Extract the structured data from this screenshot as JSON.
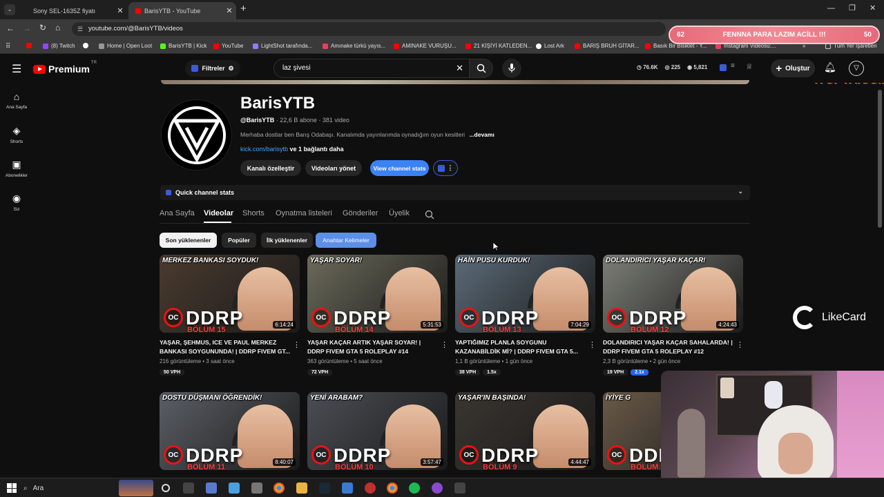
{
  "browser": {
    "tabs": [
      {
        "title": "Sony SEL-1635Z fiyatı",
        "active": false
      },
      {
        "title": "BarisYTB - YouTube",
        "active": true
      }
    ],
    "url": "youtube.com/@BarisYTB/videos",
    "bookmarks": [
      "(8) Twitch",
      "Home | Open Loot",
      "BarisYTB | Kick",
      "YouTube",
      "LightShot tarafında...",
      "Amınake türkü yayıs...",
      "AMINAKE VURUŞU...",
      "21 KİŞİYİ KATLEDEN...",
      "Lost Ark",
      "BARIŞ BRUH GİTAR...",
      "Basık Bir Bisiklet - Y...",
      "Instagram Videosu:...",
      "Tüm Yer İşaretleri"
    ]
  },
  "overlay": {
    "left_num": "62",
    "text": "FENNNA PARA LAZIM ACİLL !!!",
    "right_num": "50",
    "site": "iTOPYA.COM",
    "likecard": "LikeCard"
  },
  "header": {
    "brand": "Premium",
    "brand_sup": "TR",
    "filters": "Filtreler",
    "search_value": "laz şivesi",
    "stats": [
      "76.6K",
      "225",
      "5,821"
    ],
    "create": "Oluştur"
  },
  "sidebar": [
    {
      "label": "Ana Sayfa",
      "icon": "home-icon"
    },
    {
      "label": "Shorts",
      "icon": "shorts-icon"
    },
    {
      "label": "Abonelikler",
      "icon": "subscriptions-icon"
    },
    {
      "label": "Siz",
      "icon": "you-icon"
    }
  ],
  "channel": {
    "name": "BarisYTB",
    "handle": "@BarisYTB",
    "subs": "· 22,6 B abone · 381 video",
    "description": "Merhaba dostlar ben Barış Odabaşı. Kanalımda yayınlarımda oynadığım oyun kesitleri",
    "more": "...devamı",
    "link": "kick.com/barisytb",
    "link_more": "ve 1 bağlantı daha",
    "buttons": [
      "Kanalı özelleştir",
      "Videoları yönet",
      "View channel stats"
    ],
    "quick_stats": "Quick channel stats"
  },
  "tabs": [
    "Ana Sayfa",
    "Videolar",
    "Shorts",
    "Oynatma listeleri",
    "Gönderiler",
    "Üyelik"
  ],
  "chips": [
    "Son yüklenenler",
    "Popüler",
    "İlk yüklenenler",
    "Anahtar Kelimeler"
  ],
  "videos": [
    {
      "top": "MERKEZ BANKASI SOYDUK!",
      "bolum": "BÖLÜM 15",
      "duration": "6:14:24",
      "title": "YAŞAR, ŞEHMUS, ICE VE PAUL MERKEZ BANKASI SOYGUNUNDA! | DDRP FIVEM GT...",
      "views": "216 görüntüleme",
      "age": "3 saat önce",
      "vph": "50 VPH",
      "mult": "",
      "bg": "#4a3b2f"
    },
    {
      "top": "YAŞAR SOYAR!",
      "bolum": "BÖLÜM 14",
      "duration": "5:31:53",
      "title": "YAŞAR KAÇAR ARTIK YAŞAR SOYAR! | DDRP FIVEM GTA 5 ROLEPLAY #14",
      "views": "363 görüntüleme",
      "age": "5 saat önce",
      "vph": "72 VPH",
      "mult": "",
      "bg": "#6b6a5a"
    },
    {
      "top": "HAİN PUSU KURDUK!",
      "bolum": "BÖLÜM 13",
      "duration": "7:04:29",
      "title": "YAPTIĞIMIZ PLANLA SOYGUNU KAZANABİLDİK Mİ? | DDRP FIVEM GTA 5...",
      "views": "1,1 B görüntüleme",
      "age": "1 gün önce",
      "vph": "38 VPH",
      "mult": "1.5x",
      "bg": "#5c6b78"
    },
    {
      "top": "DOLANDIRICI YAŞAR KAÇAR!",
      "bolum": "BÖLÜM 12",
      "duration": "4:24:43",
      "title": "DOLANDIRICI YAŞAR KAÇAR SAHALARDA! | DDRP FIVEM GTA 5 ROLEPLAY #12",
      "views": "2,3 B görüntüleme",
      "age": "2 gün önce",
      "vph": "19 VPH",
      "mult": "2.1x",
      "bg": "#7d7f77"
    },
    {
      "top": "DOSTU DÜŞMANI ÖĞRENDİK!",
      "bolum": "BÖLÜM 11",
      "duration": "8:40:07",
      "title": "",
      "views": "",
      "age": "",
      "vph": "",
      "mult": "",
      "bg": "#5b5f66"
    },
    {
      "top": "YENİ ARABAM?",
      "bolum": "BÖLÜM 10",
      "duration": "3:57:47",
      "title": "",
      "views": "",
      "age": "",
      "vph": "",
      "mult": "",
      "bg": "#4b4e55"
    },
    {
      "top": "YAŞAR'IN BAŞINDA!",
      "bolum": "BÖLÜM 9",
      "duration": "4:44:47",
      "title": "",
      "views": "",
      "age": "",
      "vph": "",
      "mult": "",
      "bg": "#3a3530"
    },
    {
      "top": "İYİYE G",
      "bolum": "BÖLÜM",
      "duration": "",
      "title": "",
      "views": "",
      "age": "",
      "vph": "",
      "mult": "",
      "bg": "#6a5a48"
    }
  ],
  "taskbar": {
    "search": "Ara"
  }
}
